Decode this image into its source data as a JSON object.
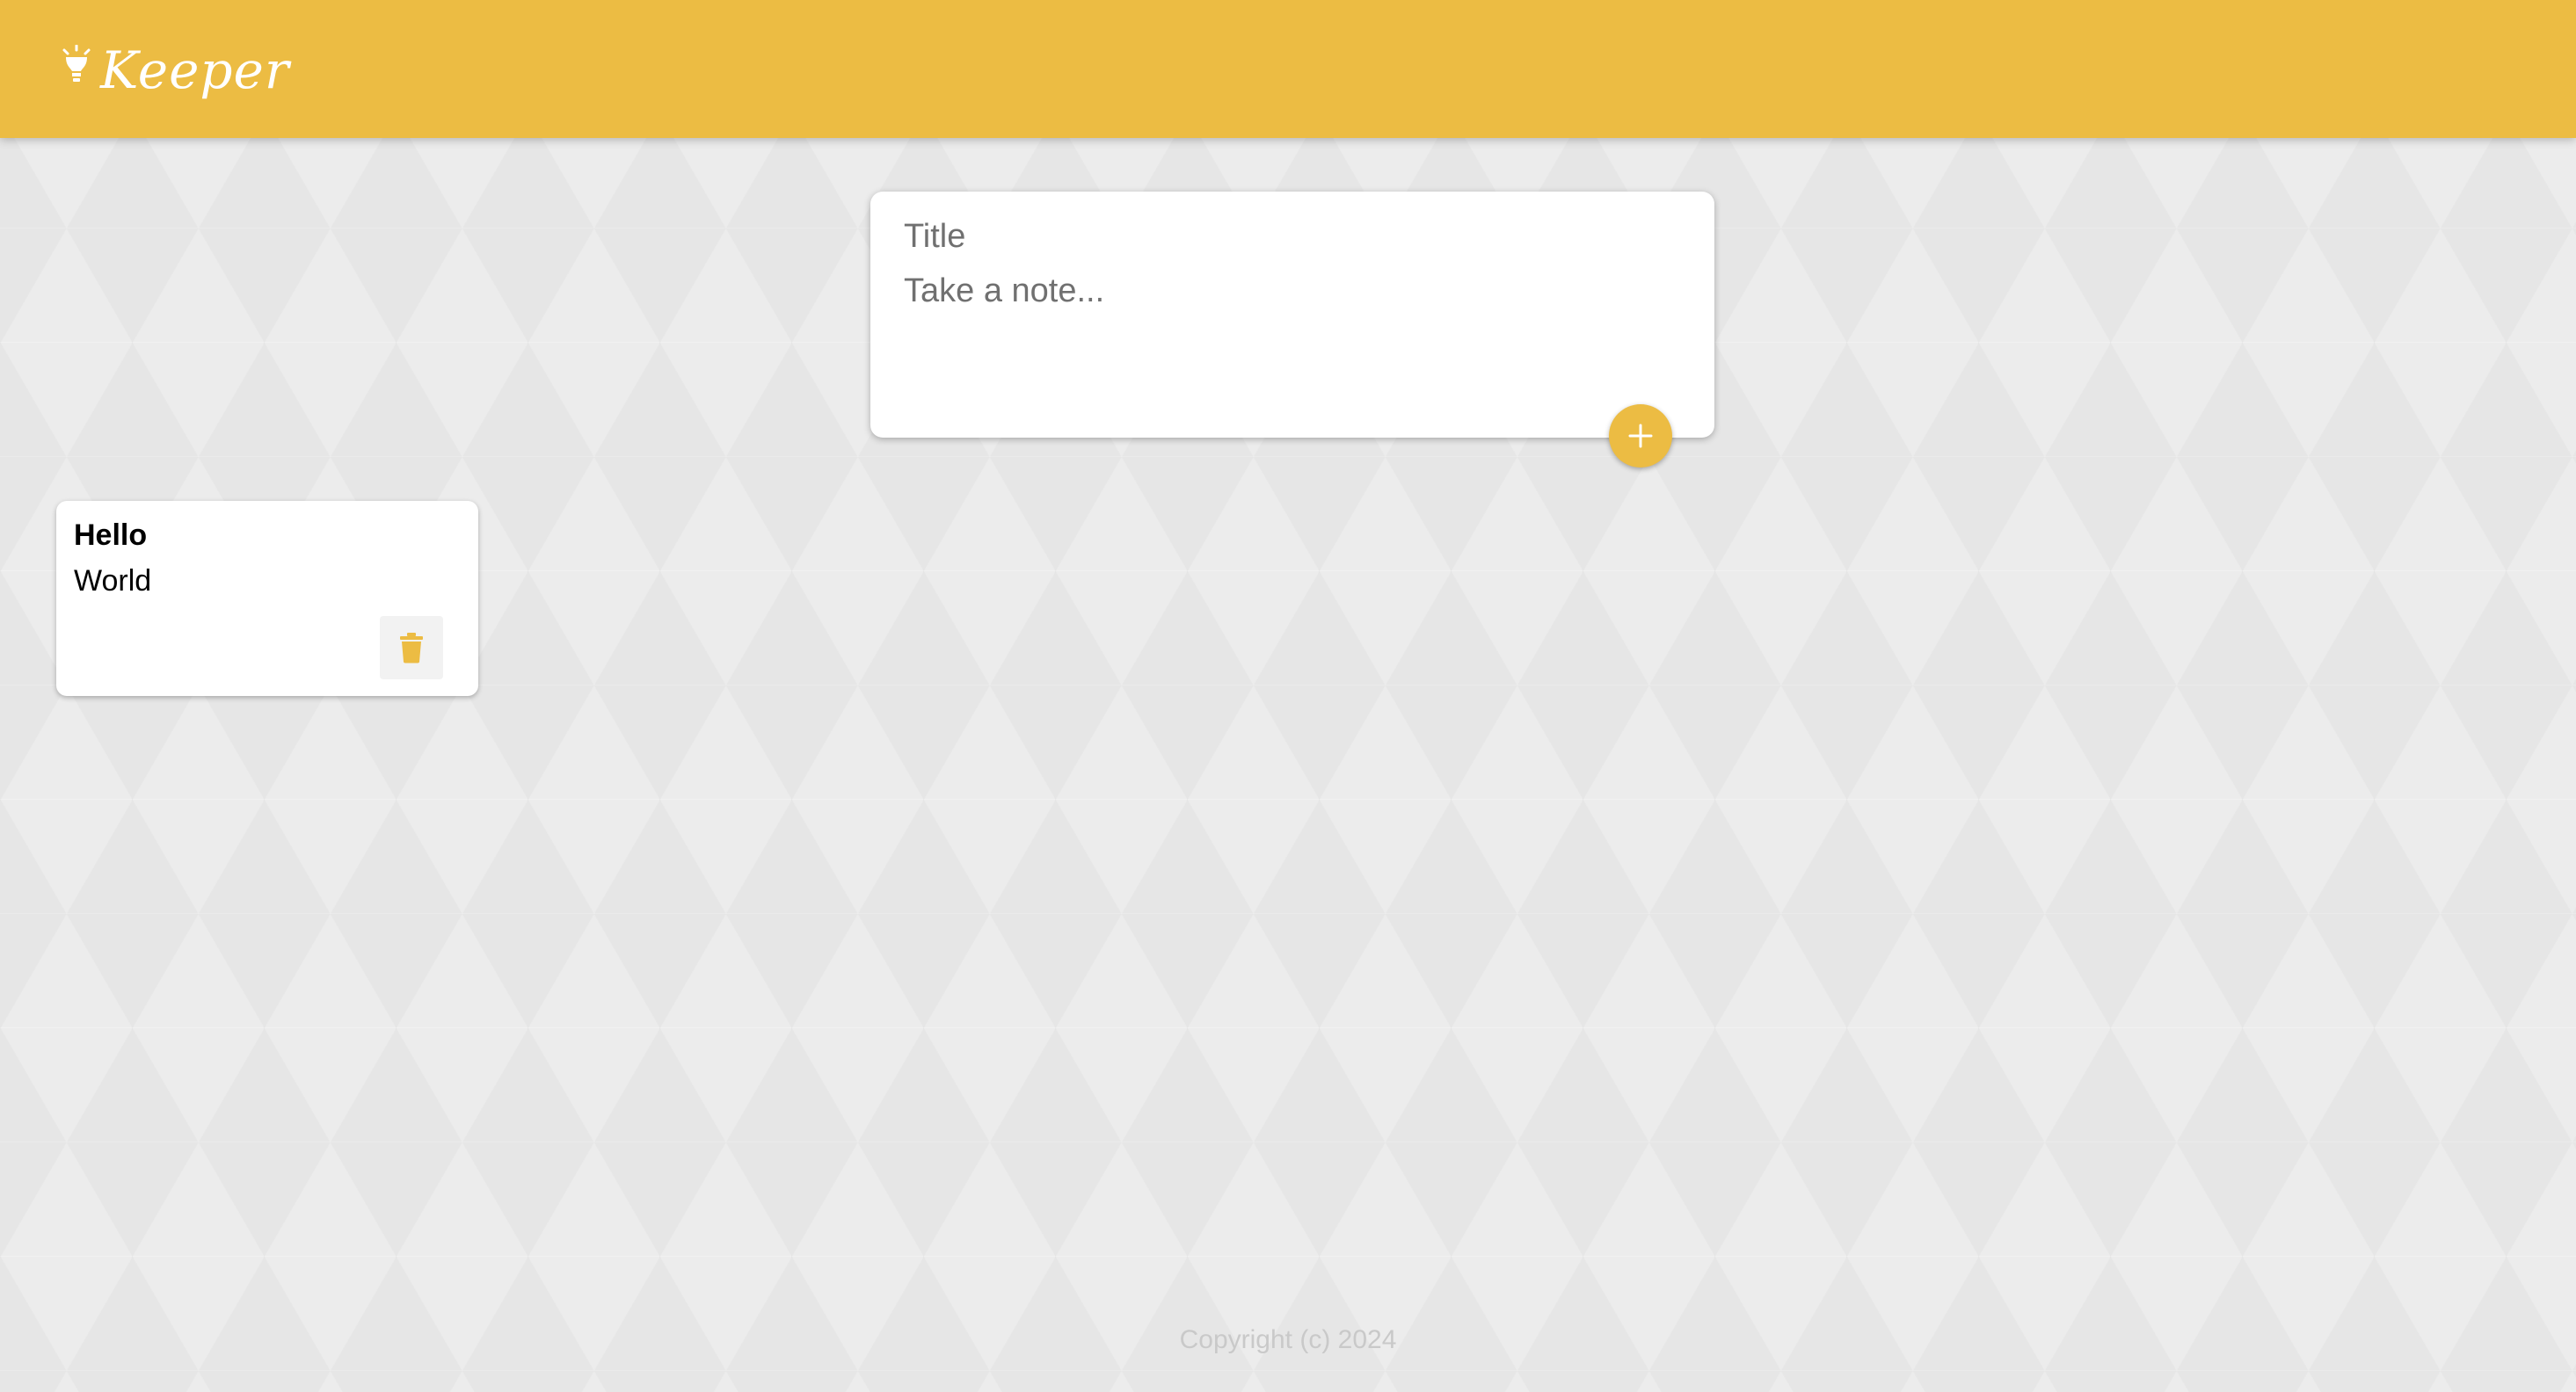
{
  "header": {
    "brand_name": "Keeper",
    "brand_icon": "lightbulb-icon",
    "color": "#ecbc43"
  },
  "composer": {
    "title_placeholder": "Title",
    "title_value": "",
    "content_placeholder": "Take a note...",
    "content_value": "",
    "add_icon": "plus-icon"
  },
  "notes": [
    {
      "title": "Hello",
      "content": "World",
      "delete_icon": "trash-icon"
    }
  ],
  "footer": {
    "text": "Copyright (c) 2024"
  },
  "colors": {
    "accent": "#ecbc43",
    "background": "#ececec",
    "footer_text": "#c9c9c9"
  }
}
